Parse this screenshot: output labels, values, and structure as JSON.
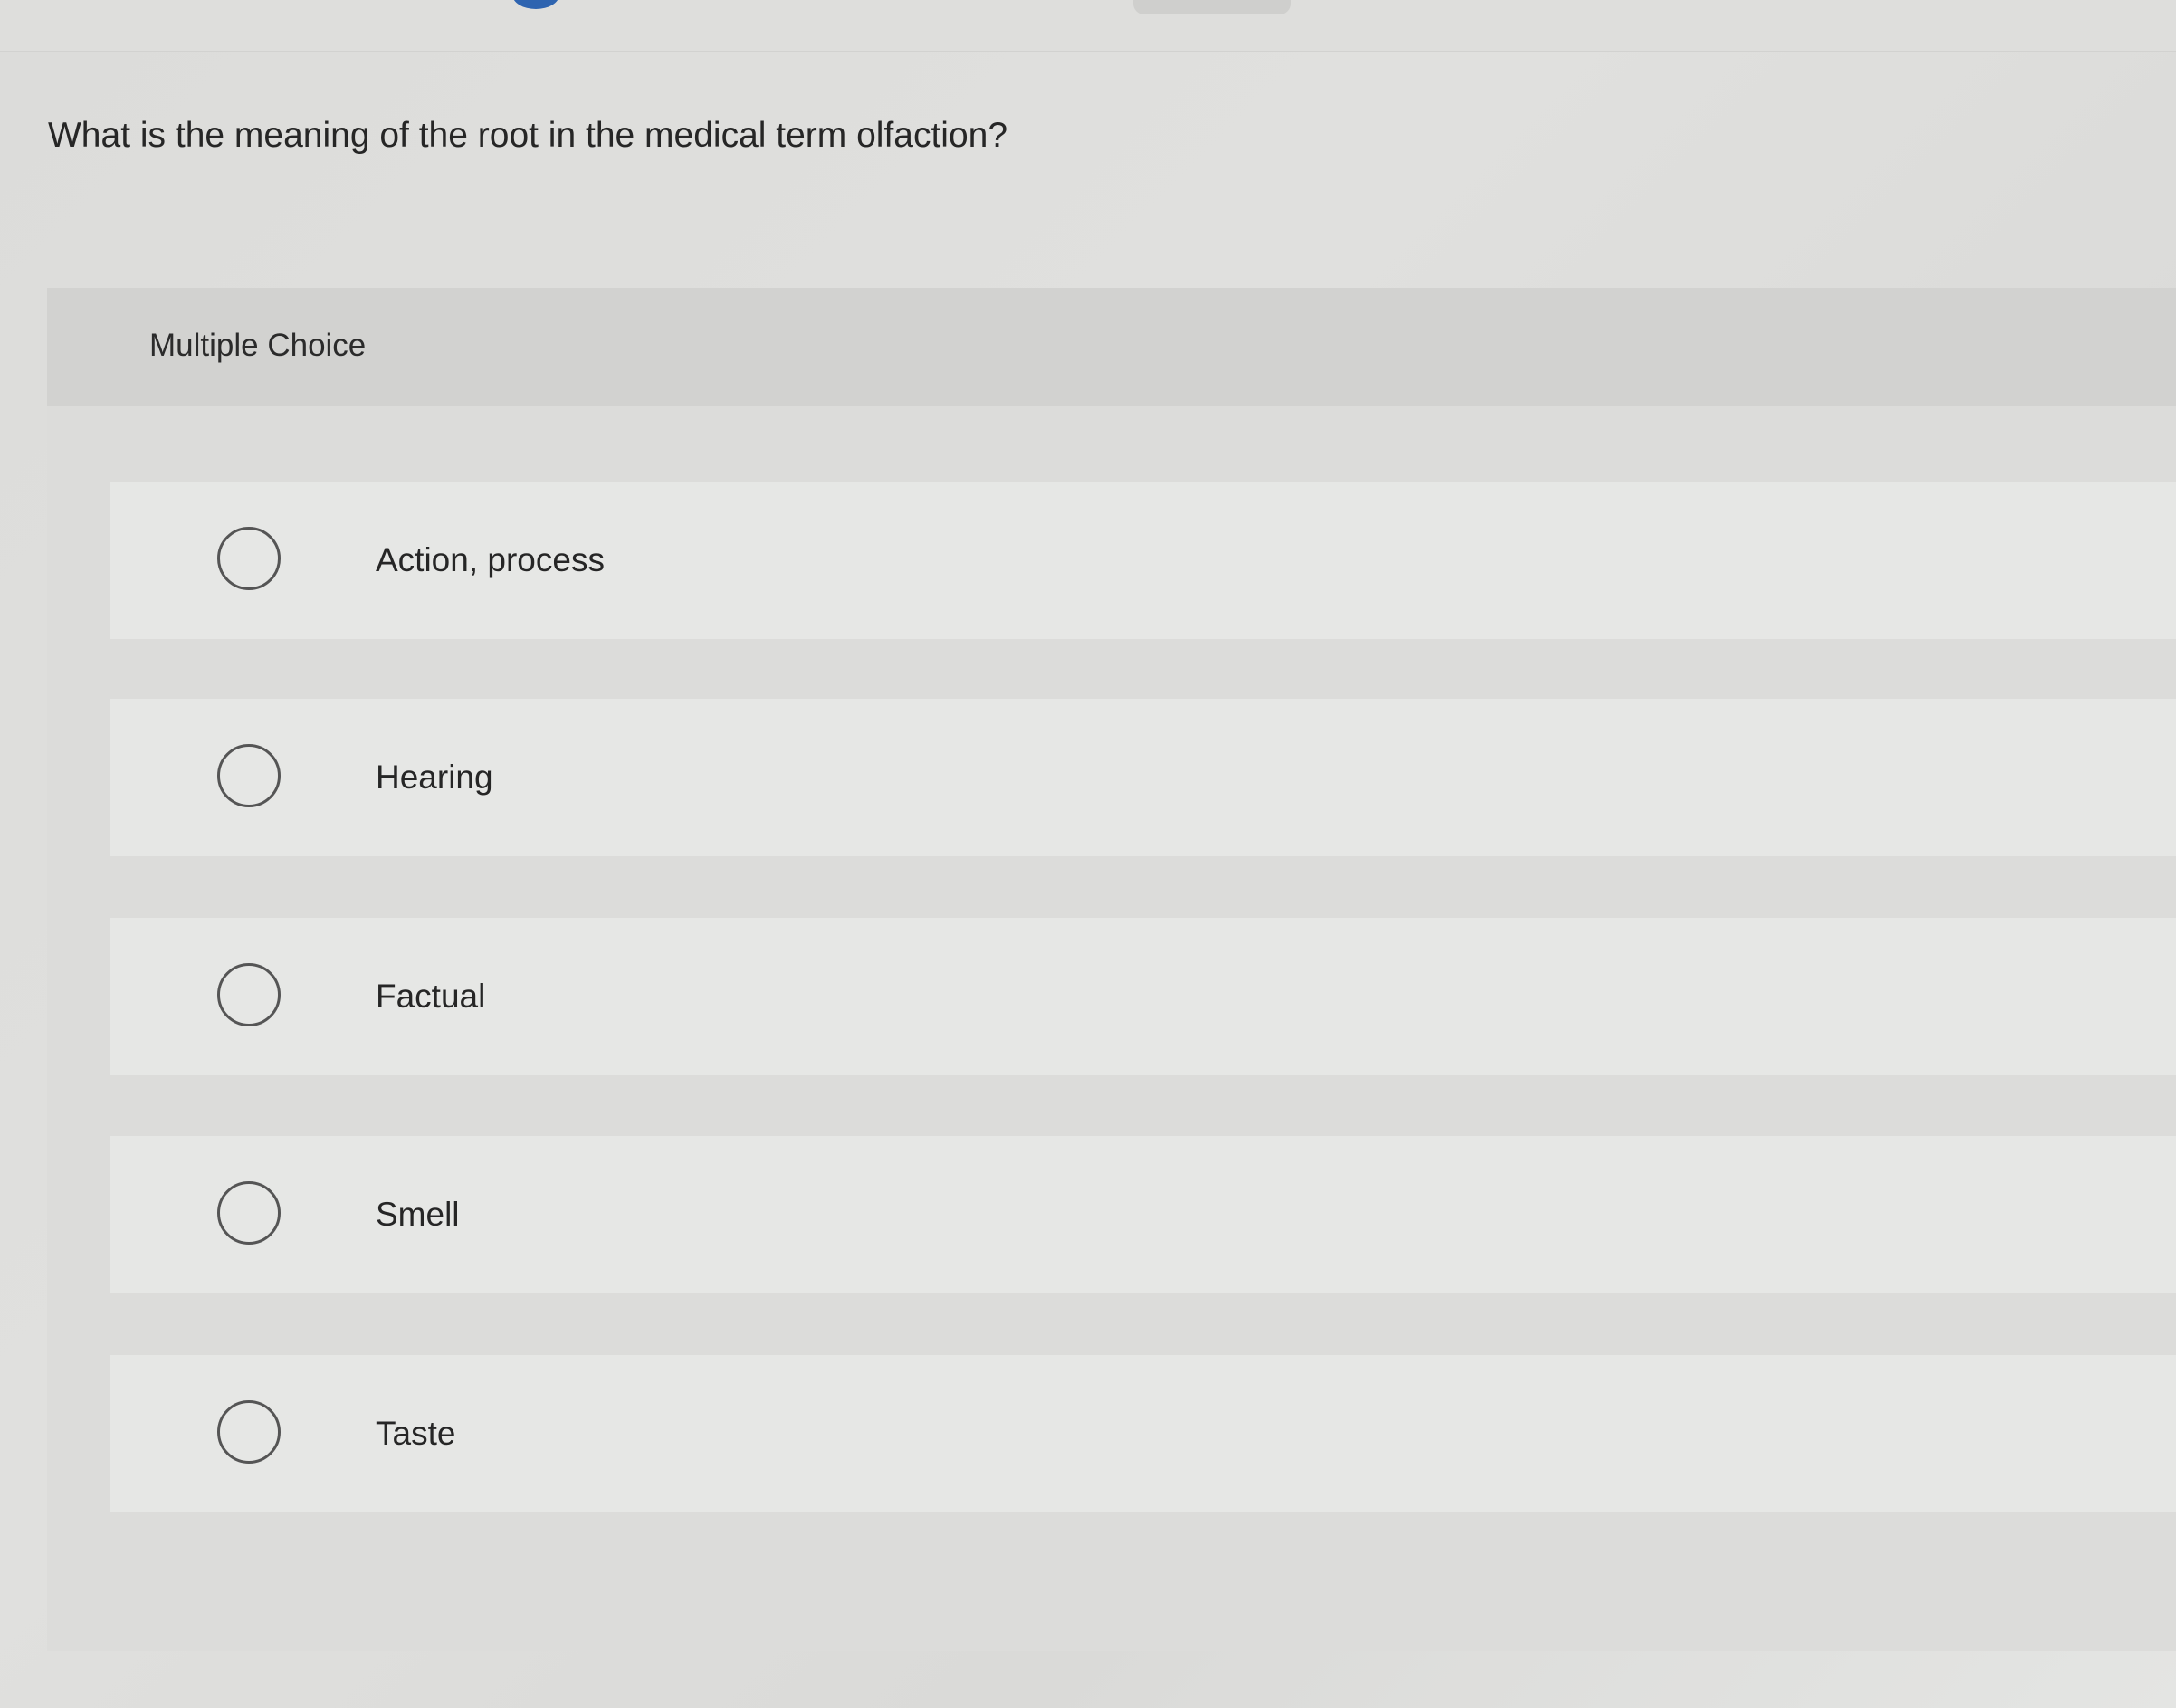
{
  "question": {
    "text": "What is the meaning of the root in the medical term olfaction?"
  },
  "multiple_choice": {
    "header_label": "Multiple Choice",
    "options": [
      {
        "label": "Action, process",
        "selected": false
      },
      {
        "label": "Hearing",
        "selected": false
      },
      {
        "label": "Factual",
        "selected": false
      },
      {
        "label": "Smell",
        "selected": false
      },
      {
        "label": "Taste",
        "selected": false
      }
    ]
  },
  "colors": {
    "background": "#dcdcda",
    "header_bar": "#d2d2d0",
    "option_row": "#e6e7e5",
    "radio_border": "#555555",
    "text": "#262626",
    "top_accent": "#2e64b0"
  }
}
